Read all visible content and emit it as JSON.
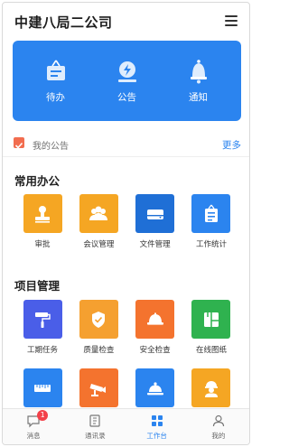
{
  "header": {
    "title": "中建八局二公司"
  },
  "banner": {
    "items": [
      {
        "label": "待办",
        "icon": "todo-sign-icon"
      },
      {
        "label": "公告",
        "icon": "announcement-icon"
      },
      {
        "label": "通知",
        "icon": "bell-icon"
      }
    ]
  },
  "notice": {
    "label": "我的公告",
    "more": "更多"
  },
  "office": {
    "title": "常用办公",
    "items": [
      {
        "label": "审批",
        "icon": "stamp-icon",
        "color": "#f5a623"
      },
      {
        "label": "会议管理",
        "icon": "people-group-icon",
        "color": "#f5a623"
      },
      {
        "label": "文件管理",
        "icon": "hard-drive-icon",
        "color": "#1f6fd6"
      },
      {
        "label": "工作统计",
        "icon": "clipboard-list-icon",
        "color": "#2b84ef"
      }
    ]
  },
  "project": {
    "title": "项目管理",
    "items": [
      {
        "label": "工期任务",
        "icon": "paint-roller-icon",
        "color": "#4a5ee8"
      },
      {
        "label": "质量检查",
        "icon": "shield-check-icon",
        "color": "#f5a030"
      },
      {
        "label": "安全检查",
        "icon": "hard-hat-icon",
        "color": "#f4732e"
      },
      {
        "label": "在线图纸",
        "icon": "blueprint-icon",
        "color": "#2fb24f"
      }
    ],
    "items_row2": [
      {
        "icon": "ruler-icon",
        "color": "#2b84ef"
      },
      {
        "icon": "cctv-camera-icon",
        "color": "#f4732e"
      },
      {
        "icon": "service-bell-icon",
        "color": "#2b84ef"
      },
      {
        "icon": "worker-icon",
        "color": "#f5a623"
      }
    ]
  },
  "tabbar": {
    "items": [
      {
        "label": "消息",
        "icon": "message-icon",
        "badge": "1"
      },
      {
        "label": "通讯录",
        "icon": "address-book-icon"
      },
      {
        "label": "工作台",
        "icon": "grid-icon",
        "active": true
      },
      {
        "label": "我的",
        "icon": "user-icon"
      }
    ]
  }
}
